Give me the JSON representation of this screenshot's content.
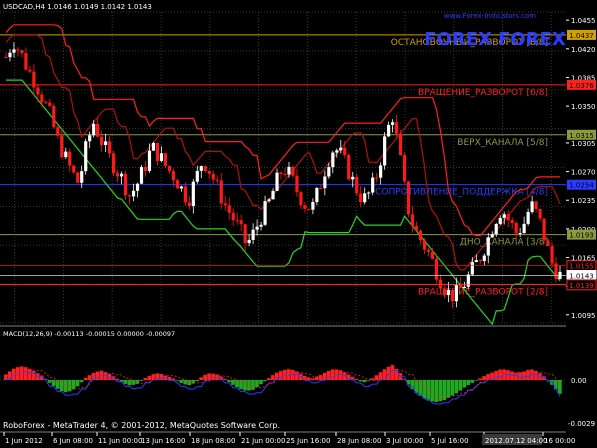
{
  "symbol_header": "USDCAD,H4  1.0146 1.0149 1.0142 1.0143",
  "watermark_lines": [
    "www.Forex-Indicators.com",
    "FOREX FOREX"
  ],
  "levels": [
    {
      "price": 1.0437,
      "label": "ОСТАНОВОЧНЫЙ_РАЗВОРОТ [8/8]",
      "color": "#d4a000",
      "tag": "1.0437"
    },
    {
      "price": 1.0376,
      "label": "ВРАЩЕНИЕ_РАЗВОРОТ [6/8]",
      "color": "#ff2020",
      "tag": "1.0376"
    },
    {
      "price": 1.0315,
      "label": "ВЕРХ_КАНАЛА [5/8]",
      "color": "#8c9a3a",
      "tag": "1.0315"
    },
    {
      "price": 1.0254,
      "label": "СОПРОТИВЛЕНИЕ_ПОДДЕРЖКА [4/8]",
      "color": "#2a3cff",
      "tag": "1.0254"
    },
    {
      "price": 1.0193,
      "label": "ДНО_КАНАЛА [3/8]",
      "color": "#8c9a3a",
      "tag": "1.0193"
    },
    {
      "price": 1.0132,
      "label": "ВРАЩЕНИЕ_РАЗВОРОТ [2/8]",
      "color": "#ff2020",
      "tag": "1.0132"
    }
  ],
  "current_price_tags": [
    "1.0155",
    "1.0143",
    "1.0139"
  ],
  "price_axis_labels": [
    "1.0455",
    "1.0420",
    "1.0385",
    "1.0350",
    "1.0305",
    "1.0270",
    "1.0235",
    "1.0200",
    "1.0165",
    "1.0130",
    "1.0095"
  ],
  "macd_header": "MACD(12,26,9) -0.00113 -0.00015 0.00000 -0.00097",
  "macd_axis_labels": [
    "0.00",
    "-0.0029"
  ],
  "copyright": "RoboForex - MetaTrader 4, © 2001-2012, MetaQuotes Software Corp.",
  "time_labels": [
    "1 Jun 2012",
    "6 Jun 08:00",
    "11 Jun 00:00",
    "13 Jun 16:00",
    "18 Jun 08:00",
    "21 Jun 00:00",
    "25 Jun 16:00",
    "28 Jun 08:00",
    "3 Jul 00:00",
    "5 Jul 16:00",
    "2012.07.12 04:00",
    "16 00:00"
  ],
  "colors": {
    "bull": "#ffffff",
    "bear": "#ff1a1a",
    "grid": "#3a3a3a",
    "support_line": "#22d822",
    "resistance_line": "#ff2020",
    "macd_pos": "#ff2020",
    "macd_neg": "#22a822",
    "macd_signal": "#2a3cff"
  },
  "chart_data": {
    "type": "candlestick",
    "symbol": "USDCAD",
    "timeframe": "H4",
    "ylim": [
      1.0085,
      1.0465
    ],
    "close_path": [
      1.041,
      1.043,
      1.0415,
      1.0395,
      1.038,
      1.036,
      1.034,
      1.031,
      1.029,
      1.027,
      1.0255,
      1.03,
      1.033,
      1.031,
      1.029,
      1.0275,
      1.026,
      1.024,
      1.0255,
      1.0275,
      1.03,
      1.029,
      1.0275,
      1.0265,
      1.025,
      1.0235,
      1.026,
      1.0285,
      1.027,
      1.025,
      1.023,
      1.0215,
      1.02,
      1.018,
      1.0195,
      1.0215,
      1.023,
      1.0255,
      1.0275,
      1.0265,
      1.0245,
      1.023,
      1.0225,
      1.025,
      1.028,
      1.03,
      1.029,
      1.027,
      1.025,
      1.0235,
      1.0245,
      1.027,
      1.031,
      1.034,
      1.029,
      1.023,
      1.02,
      1.0185,
      1.017,
      1.015,
      1.013,
      1.0118,
      1.0122,
      1.0135,
      1.015,
      1.0165,
      1.0185,
      1.021,
      1.0225,
      1.021,
      1.0195,
      1.0205,
      1.023,
      1.0215,
      1.0185,
      1.0155,
      1.0143
    ],
    "macd_hist": [
      0.0004,
      0.0008,
      0.001,
      0.0009,
      0.0006,
      0.0003,
      -0.0002,
      -0.0006,
      -0.0009,
      -0.0008,
      -0.0004,
      0.0002,
      0.0005,
      0.0007,
      0.0005,
      0.0002,
      -0.0002,
      -0.0004,
      -0.0003,
      0.0001,
      0.0004,
      0.0005,
      0.0003,
      0.0001,
      -0.0002,
      -0.0004,
      -0.0002,
      0.0003,
      0.0005,
      0.0004,
      0.0001,
      -0.0003,
      -0.0006,
      -0.0008,
      -0.0007,
      -0.0003,
      0.0001,
      0.0005,
      0.0007,
      0.0008,
      0.0006,
      0.0003,
      0.0001,
      0.0003,
      0.0006,
      0.0008,
      0.0007,
      0.0004,
      0.0001,
      -0.0002,
      0.0,
      0.0004,
      0.0008,
      0.0011,
      0.0006,
      -0.0002,
      -0.0008,
      -0.0012,
      -0.0015,
      -0.0016,
      -0.0015,
      -0.0012,
      -0.0009,
      -0.0005,
      -0.0002,
      0.0001,
      0.0004,
      0.0006,
      0.0008,
      0.0007,
      0.0005,
      0.0006,
      0.0008,
      0.0006,
      0.0002,
      -0.0004,
      -0.001
    ],
    "macd_ylim": [
      -0.0029,
      0.0029
    ]
  }
}
